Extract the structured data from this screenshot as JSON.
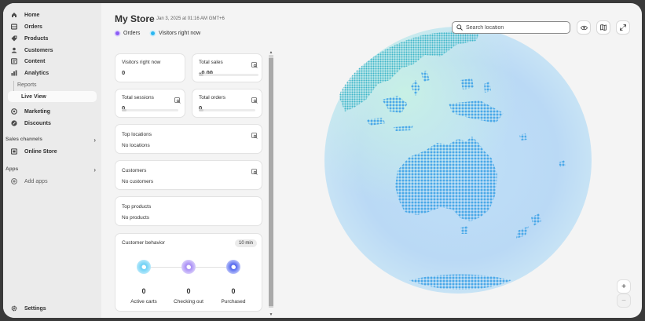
{
  "sidebar": {
    "items": [
      {
        "label": "Home",
        "icon": "home-icon"
      },
      {
        "label": "Orders",
        "icon": "orders-icon"
      },
      {
        "label": "Products",
        "icon": "tag-icon"
      },
      {
        "label": "Customers",
        "icon": "person-icon"
      },
      {
        "label": "Content",
        "icon": "content-icon"
      },
      {
        "label": "Analytics",
        "icon": "analytics-icon"
      }
    ],
    "analytics_sub": [
      "Reports",
      "Live View"
    ],
    "items2": [
      {
        "label": "Marketing",
        "icon": "target-icon"
      },
      {
        "label": "Discounts",
        "icon": "discount-icon"
      }
    ],
    "sales_channels_label": "Sales channels",
    "online_store": "Online Store",
    "apps_label": "Apps",
    "add_apps": "Add apps",
    "settings": "Settings"
  },
  "header": {
    "title": "My Store",
    "date": "Jan 3, 2025 at 01:16 AM GMT+6",
    "legend": [
      {
        "label": "Orders",
        "color": "#8b5cf6"
      },
      {
        "label": "Visitors right now",
        "color": "#2bb6f0"
      }
    ]
  },
  "metrics": {
    "visitors": {
      "label": "Visitors right now",
      "value": "0"
    },
    "sales": {
      "label": "Total sales",
      "value": "₀0.00"
    },
    "sessions": {
      "label": "Total sessions",
      "value": "0"
    },
    "orders": {
      "label": "Total orders",
      "value": "0"
    }
  },
  "panels": {
    "locations": {
      "title": "Top locations",
      "empty": "No locations"
    },
    "customers": {
      "title": "Customers",
      "empty": "No customers"
    },
    "products": {
      "title": "Top products",
      "empty": "No products"
    }
  },
  "behavior": {
    "title": "Customer behavior",
    "badge": "10 min",
    "steps": [
      {
        "value": "0",
        "label": "Active carts",
        "color": "#6ad0f5"
      },
      {
        "value": "0",
        "label": "Checking out",
        "color": "#a78bf5"
      },
      {
        "value": "0",
        "label": "Purchased",
        "color": "#6a7cf5"
      }
    ]
  },
  "map": {
    "search_placeholder": "Search location",
    "zoom_in": "+",
    "zoom_out": "−"
  }
}
